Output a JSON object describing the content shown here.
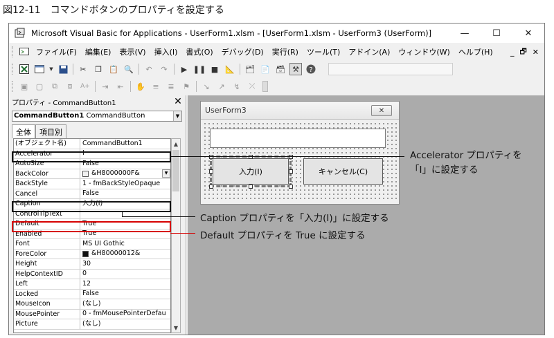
{
  "figure_caption": "図12-11　コマンドボタンのプロパティを設定する",
  "window": {
    "title": "Microsoft Visual Basic for Applications - UserForm1.xlsm - [UserForm1.xlsm - UserForm3 (UserForm)]",
    "controls": {
      "minimize": "—",
      "maximize": "☐",
      "close": "✕"
    }
  },
  "menu": {
    "items": [
      "ファイル(F)",
      "編集(E)",
      "表示(V)",
      "挿入(I)",
      "書式(O)",
      "デバッグ(D)",
      "実行(R)",
      "ツール(T)",
      "アドイン(A)",
      "ウィンドウ(W)",
      "ヘルプ(H)"
    ],
    "right": [
      "_",
      "🗗",
      "✕"
    ]
  },
  "properties": {
    "header": "プロパティ - CommandButton1",
    "close": "✕",
    "object_name": "CommandButton1",
    "object_type": "CommandButton",
    "tabs": [
      "全体",
      "項目別"
    ],
    "rows": [
      {
        "name": "(オブジェクト名)",
        "value": "CommandButton1"
      },
      {
        "name": "Accelerator",
        "value": "I"
      },
      {
        "name": "AutoSize",
        "value": "False"
      },
      {
        "name": "BackColor",
        "value": "&H8000000F&"
      },
      {
        "name": "BackStyle",
        "value": "1 - fmBackStyleOpaque"
      },
      {
        "name": "Cancel",
        "value": "False"
      },
      {
        "name": "Caption",
        "value": "入力(I)"
      },
      {
        "name": "ControlTipText",
        "value": ""
      },
      {
        "name": "Default",
        "value": "True"
      },
      {
        "name": "Enabled",
        "value": "True"
      },
      {
        "name": "Font",
        "value": "MS UI Gothic"
      },
      {
        "name": "ForeColor",
        "value": "&H80000012&"
      },
      {
        "name": "Height",
        "value": "30"
      },
      {
        "name": "HelpContextID",
        "value": "0"
      },
      {
        "name": "Left",
        "value": "12"
      },
      {
        "name": "Locked",
        "value": "False"
      },
      {
        "name": "MouseIcon",
        "value": "(なし)"
      },
      {
        "name": "MousePointer",
        "value": "0 - fmMousePointerDefau"
      },
      {
        "name": "Picture",
        "value": "(なし)"
      }
    ]
  },
  "userform": {
    "title": "UserForm3",
    "close": "✕",
    "button_input": "入力(I)",
    "button_cancel": "キャンセル(C)"
  },
  "annotations": {
    "accelerator_line1": "Accelerator プロパティを",
    "accelerator_line2": "「I」に設定する",
    "caption": "Caption プロパティを「入力(I)」に設定する",
    "default": "Default プロパティを True に設定する"
  },
  "colors": {
    "highlight_black": "#111111",
    "highlight_red": "#d60000",
    "designer_bg": "#ababab"
  }
}
